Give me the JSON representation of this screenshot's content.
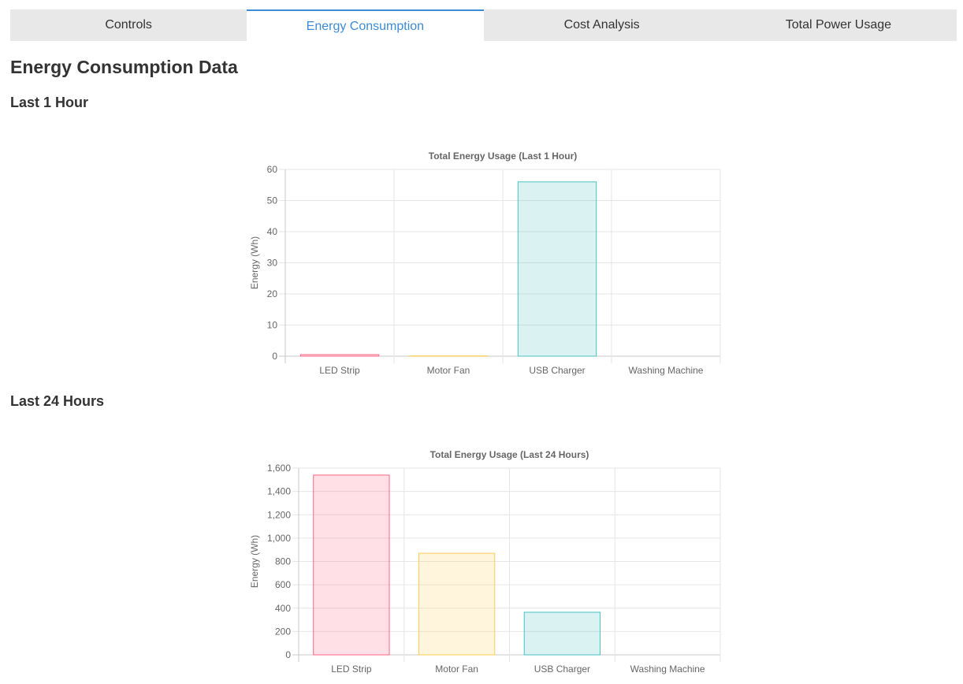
{
  "tabs": [
    {
      "label": "Controls",
      "active": false
    },
    {
      "label": "Energy Consumption",
      "active": true
    },
    {
      "label": "Cost Analysis",
      "active": false
    },
    {
      "label": "Total Power Usage",
      "active": false
    }
  ],
  "page_title": "Energy Consumption Data",
  "sections": [
    {
      "heading": "Last 1 Hour"
    },
    {
      "heading": "Last 24 Hours"
    }
  ],
  "colors": {
    "accent": "#3d8bd2",
    "led_strip": "#ff6384",
    "motor_fan": "#ffcd56",
    "usb_charger": "#4bc0c0",
    "washing_machine": "#9966ff"
  },
  "chart_data": [
    {
      "type": "bar",
      "title": "Total Energy Usage (Last 1 Hour)",
      "xlabel": "",
      "ylabel": "Energy (Wh)",
      "categories": [
        "LED Strip",
        "Motor Fan",
        "USB Charger",
        "Washing Machine"
      ],
      "values": [
        0.5,
        0.1,
        56,
        0
      ],
      "ylim": [
        0,
        60
      ],
      "yticks": [
        0,
        10,
        20,
        30,
        40,
        50,
        60
      ],
      "ytick_labels": [
        "0",
        "10",
        "20",
        "30",
        "40",
        "50",
        "60"
      ],
      "grid": true
    },
    {
      "type": "bar",
      "title": "Total Energy Usage (Last 24 Hours)",
      "xlabel": "",
      "ylabel": "Energy (Wh)",
      "categories": [
        "LED Strip",
        "Motor Fan",
        "USB Charger",
        "Washing Machine"
      ],
      "values": [
        1540,
        870,
        365,
        0
      ],
      "ylim": [
        0,
        1600
      ],
      "yticks": [
        0,
        200,
        400,
        600,
        800,
        1000,
        1200,
        1400,
        1600
      ],
      "ytick_labels": [
        "0",
        "200",
        "400",
        "600",
        "800",
        "1,000",
        "1,200",
        "1,400",
        "1,600"
      ],
      "grid": true
    }
  ]
}
